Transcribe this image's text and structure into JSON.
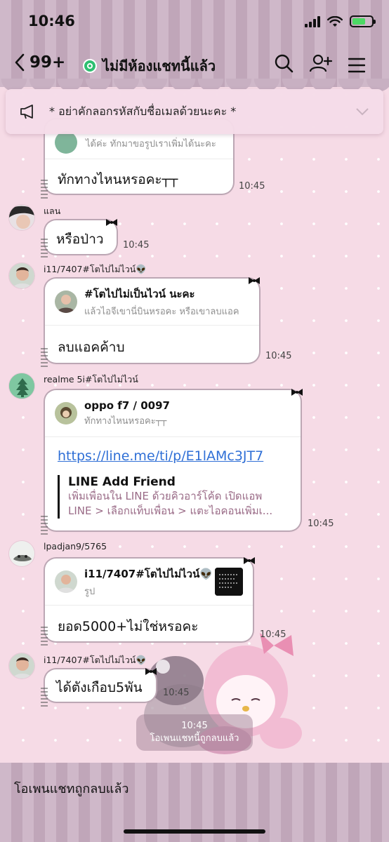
{
  "status_bar": {
    "time": "10:46",
    "battery_level": 0.7
  },
  "header": {
    "back_count": "99+",
    "room_title": "ไม่มีห้องแชทนี้แล้ว",
    "icons": [
      "chevron-left-icon",
      "search-icon",
      "add-friend-icon",
      "menu-icon"
    ]
  },
  "announcement": {
    "text": "* อย่าคักลอกรหัสกับชื่อเมลด้วยนะคะ *"
  },
  "messages": [
    {
      "quote_sub": "ได้ค่ะ ทักมาขอรูปเราเพิ่มได้นะคะ",
      "text": "ทักทางไหนหรอคะ┬┬",
      "time": "10:45"
    },
    {
      "sender": "แลน",
      "text": "หรือป่าว",
      "time": "10:45"
    },
    {
      "sender": "i11/7407#โตไปไม่ไวน์👽",
      "quote_name": "#โตไปไม่เป็นไวน์ นะคะ",
      "quote_sub": "แล้วไอจีเขานี่บินหรอคะ หรือเขาลบแอค",
      "text": "ลบแอคค้าบ",
      "time": "10:45"
    },
    {
      "sender": "realme 5i#โตไปไม่ไวน์",
      "quote_name": "oppo f7 / 0097",
      "quote_sub": "ทักทางไหนหรอคะ┬┬",
      "link": "https://line.me/ti/p/E1lAMc3JT7",
      "preview_title": "LINE Add Friend",
      "preview_line1": "เพิ่มเพื่อนใน LINE ด้วยคิวอาร์โค้ด เปิดแอพ",
      "preview_line2": "LINE > เลือกแท็บเพื่อน > แตะไอคอนเพิ่มเ...",
      "time": "10:45"
    },
    {
      "sender": "lpadjan9/5765",
      "quote_name": "i11/7407#โตไปไม่ไวน์👽",
      "quote_sub": "รูป",
      "text": "ยอด5000+ไม่ใช่หรอคะ",
      "time": "10:45"
    },
    {
      "sender": "i11/7407#โตไปไม่ไวน์👽",
      "text": "ได้ตังเกือบ5พัน",
      "time": "10:45"
    }
  ],
  "system_message": {
    "time": "10:45",
    "text": "โอเพนแชทนี้ถูกลบแล้ว"
  },
  "footer": {
    "text": "โอเพนแชทถูกลบแล้ว"
  },
  "colors": {
    "background": "#f6dbe6",
    "stripe_light": "#cfb8c9",
    "stripe_dark": "#c0a6b9",
    "link": "#2f6fd6",
    "room_badge": "#2fbf71"
  }
}
